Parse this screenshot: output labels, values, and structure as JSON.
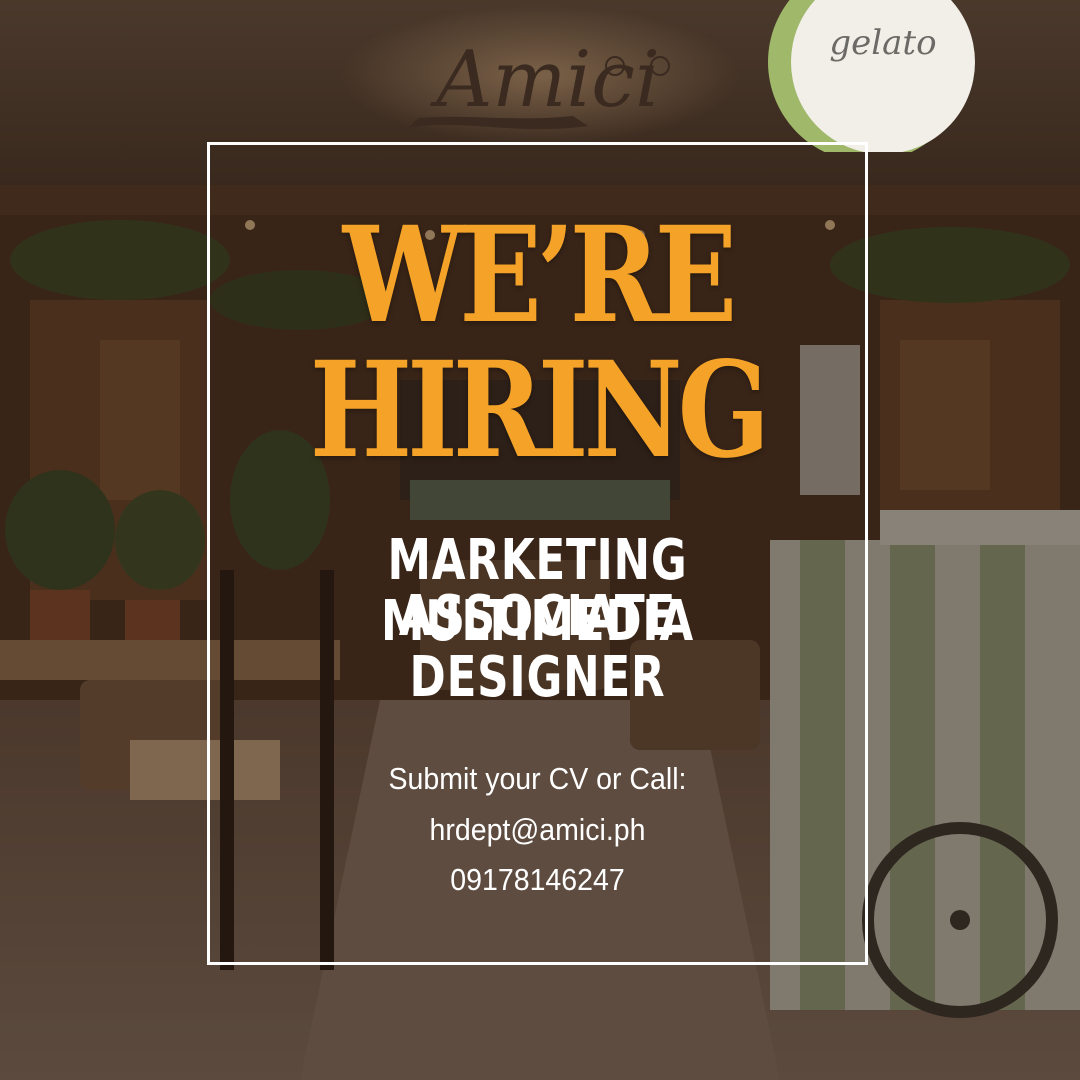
{
  "brand": {
    "logo_text": "Amici",
    "sign_text": "gelato"
  },
  "headline": {
    "line1": "WE’RE",
    "line2": "HIRING"
  },
  "positions": [
    "MARKETING ASSOCIATE",
    "MULTIMEDIA DESIGNER"
  ],
  "contact": {
    "prompt": "Submit your CV or Call:",
    "email": "hrdept@amici.ph",
    "phone": "09178146247"
  },
  "colors": {
    "accent": "#f5a328",
    "text": "#ffffff",
    "overlay": "#2a1c14"
  }
}
